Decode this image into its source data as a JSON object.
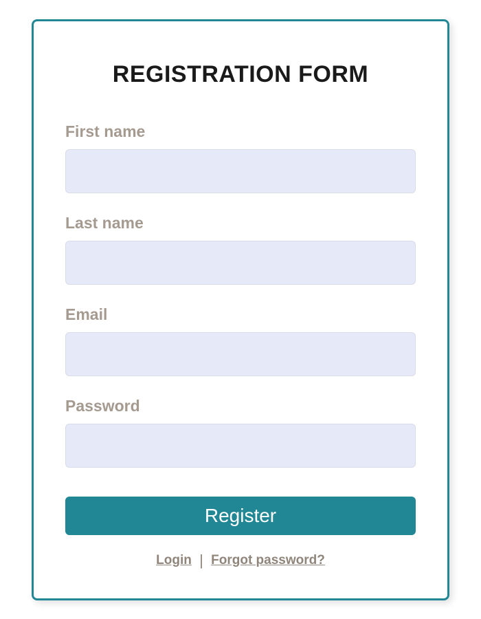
{
  "title": "REGISTRATION FORM",
  "fields": {
    "firstName": {
      "label": "First name",
      "value": ""
    },
    "lastName": {
      "label": "Last name",
      "value": ""
    },
    "email": {
      "label": "Email",
      "value": ""
    },
    "password": {
      "label": "Password",
      "value": ""
    }
  },
  "submit": {
    "label": "Register"
  },
  "links": {
    "login": "Login",
    "forgot": "Forgot password?"
  },
  "colors": {
    "accent": "#228795",
    "inputBg": "#e6e9f7",
    "labelGray": "#a59a90"
  }
}
